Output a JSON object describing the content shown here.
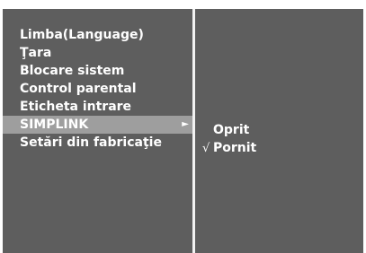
{
  "menu": {
    "items": [
      {
        "label": "Limba(Language)"
      },
      {
        "label": "Ţara"
      },
      {
        "label": "Blocare sistem"
      },
      {
        "label": "Control parental"
      },
      {
        "label": "Eticheta intrare"
      },
      {
        "label": "SIMPLINK",
        "selected": true
      },
      {
        "label": "Setări din fabricaţie"
      }
    ],
    "submenu_arrow": "►"
  },
  "submenu": {
    "options": [
      {
        "label": "Oprit",
        "checked": false
      },
      {
        "label": "Pornit",
        "checked": true
      }
    ],
    "check_mark": "√"
  },
  "colors": {
    "panel_bg": "#5e5e5e",
    "highlight_bg": "#9e9e9e",
    "divider": "#f2f2f2",
    "text": "#ffffff"
  }
}
